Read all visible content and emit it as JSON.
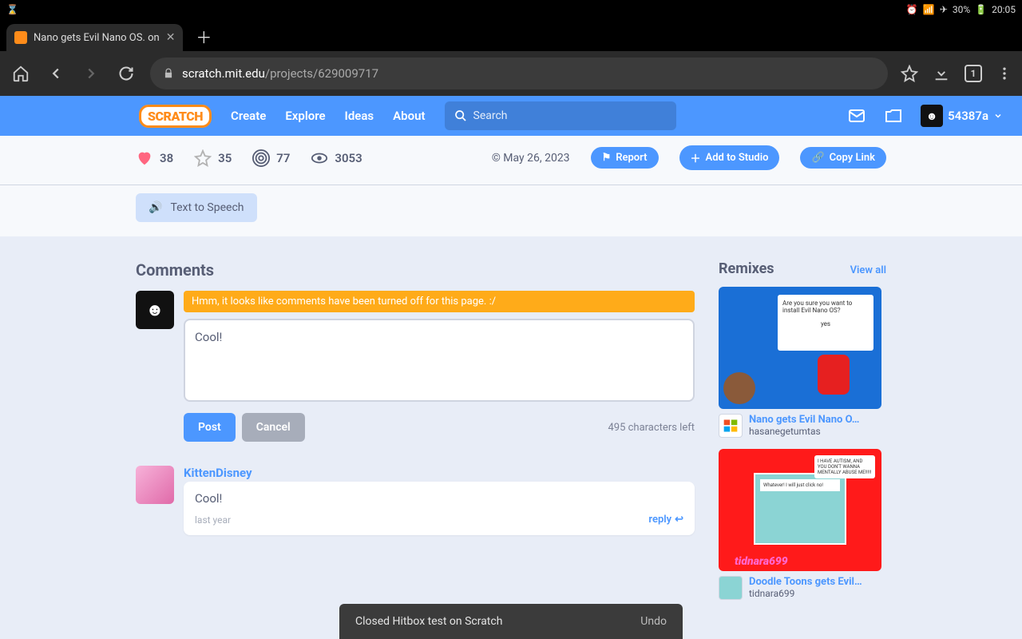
{
  "statusbar": {
    "battery": "30%",
    "time": "20:05"
  },
  "tab": {
    "title": "Nano gets Evil Nano OS. on"
  },
  "url": {
    "host": "scratch.mit.edu",
    "path": "/projects/629009717"
  },
  "nav": {
    "logo": "SCRATCH",
    "create": "Create",
    "explore": "Explore",
    "ideas": "Ideas",
    "about": "About",
    "search_placeholder": "Search",
    "username": "54387a"
  },
  "stats": {
    "loves": "38",
    "favs": "35",
    "remixes": "77",
    "views": "3053",
    "date": "© May 26, 2023",
    "report": "Report",
    "add_studio": "Add to Studio",
    "copy_link": "Copy Link"
  },
  "tts": {
    "label": "Text to Speech"
  },
  "comments": {
    "heading": "Comments",
    "warning": "Hmm, it looks like comments have been turned off for this page. :/",
    "draft": "Cool!",
    "post": "Post",
    "cancel": "Cancel",
    "chars_left": "495 characters left",
    "item": {
      "user": "KittenDisney",
      "text": "Cool!",
      "time": "last year",
      "reply": "reply"
    }
  },
  "remixes": {
    "heading": "Remixes",
    "view_all": "View all",
    "r1": {
      "title": "Nano gets Evil Nano O…",
      "author": "hasanegetumtas",
      "dialog1": "Are you sure you want to install Evil Nano OS?",
      "dialog2": "yes"
    },
    "r2": {
      "title": "Doodle Toons gets Evil…",
      "author": "tidnara699"
    }
  },
  "snackbar": {
    "text": "Closed Hitbox test on Scratch",
    "undo": "Undo"
  }
}
